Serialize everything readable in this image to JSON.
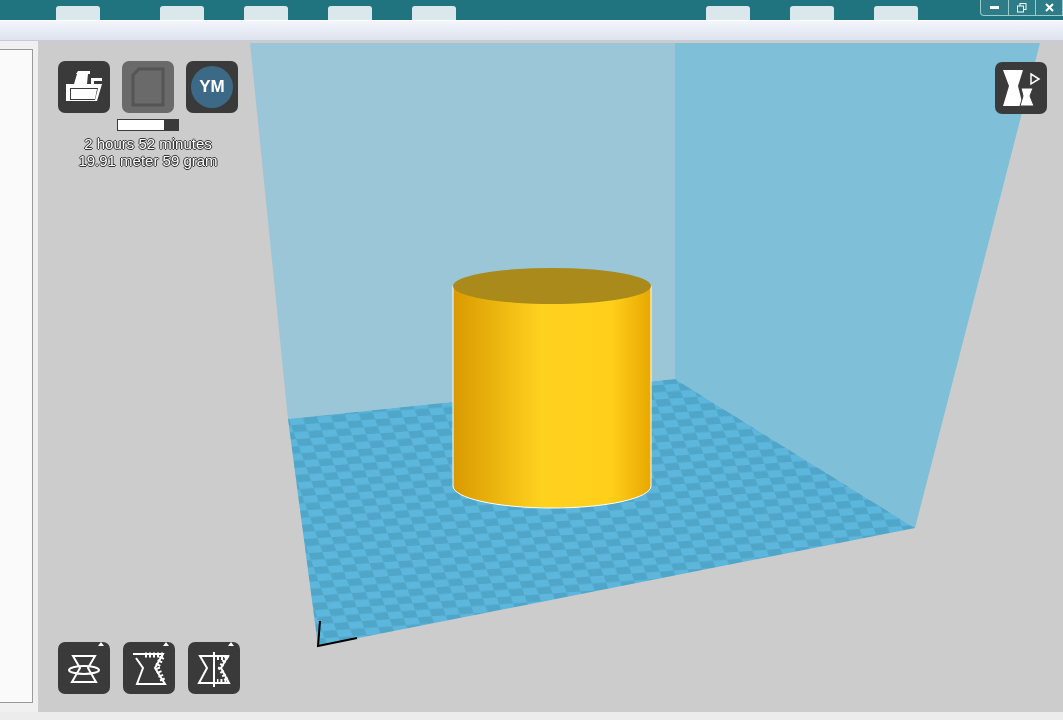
{
  "toolbar": {
    "buttons": [
      {
        "kind": "load",
        "disabled": false
      },
      {
        "kind": "sd",
        "disabled": true
      },
      {
        "kind": "youmagine",
        "label": "YM",
        "disabled": false
      }
    ]
  },
  "progress": {
    "level": 0.76
  },
  "print_time": "2 hours 52 minutes",
  "material": "19.91 meter 59 gram",
  "tool_buttons": [
    {
      "kind": "rotate"
    },
    {
      "kind": "scale"
    },
    {
      "kind": "mirror"
    }
  ]
}
